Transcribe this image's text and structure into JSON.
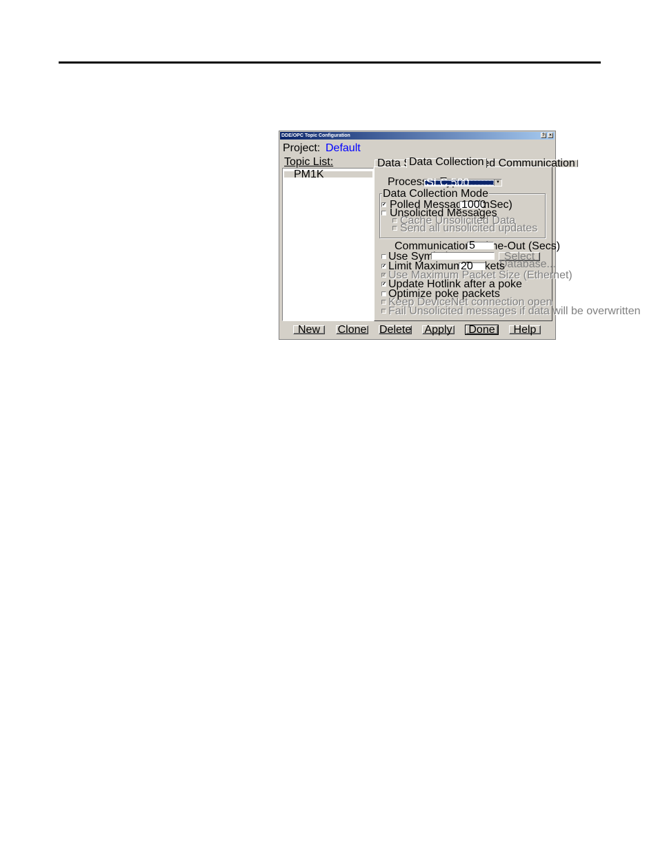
{
  "dialog": {
    "title": "DDE/OPC Topic Configuration",
    "help_glyph": "?",
    "close_glyph": "×",
    "project_label": "Project:",
    "project_value": "Default",
    "topic_list_label": "Topic List:",
    "topics": [
      "PM1K"
    ],
    "tabs": [
      "Data Source",
      "Data Collection",
      "Advanced Communication"
    ],
    "active_tab": "Data Collection",
    "processor_type_label": "Processor Type:",
    "processor_type_value": "SLC 500",
    "data_collection_mode_label": "Data Collection Mode",
    "polled_label": "Polled Messages (mSec)",
    "polled_value": "1000",
    "unsolicited_label": "Unsolicited Messages",
    "cache_unsolicited_label": "Cache Unsolicited Data",
    "send_unsolicited_label": "Send all unsolicited updates",
    "timeout_label": "Communications Time-Out (Secs)",
    "timeout_value": "5",
    "use_symbols_label": "Use Symbols",
    "symbols_value": "",
    "select_database_label": "Select Database...",
    "limit_packets_label": "Limit Maximum Packets",
    "limit_packets_value": "20",
    "max_packet_size_label": "Use Maximum Packet Size (Ethernet)",
    "update_hotlink_label": "Update Hotlink after a poke",
    "optimize_poke_label": "Optimize poke packets",
    "keep_devicenet_label": "Keep DeviceNet connection open",
    "fail_unsolicited_label": "Fail Unsolicited messages if data will be overwritten",
    "checked_glyph": "✓",
    "buttons": {
      "new": "New",
      "clone": "Clone",
      "delete": "Delete",
      "apply": "Apply",
      "done": "Done",
      "help": "Help"
    }
  }
}
